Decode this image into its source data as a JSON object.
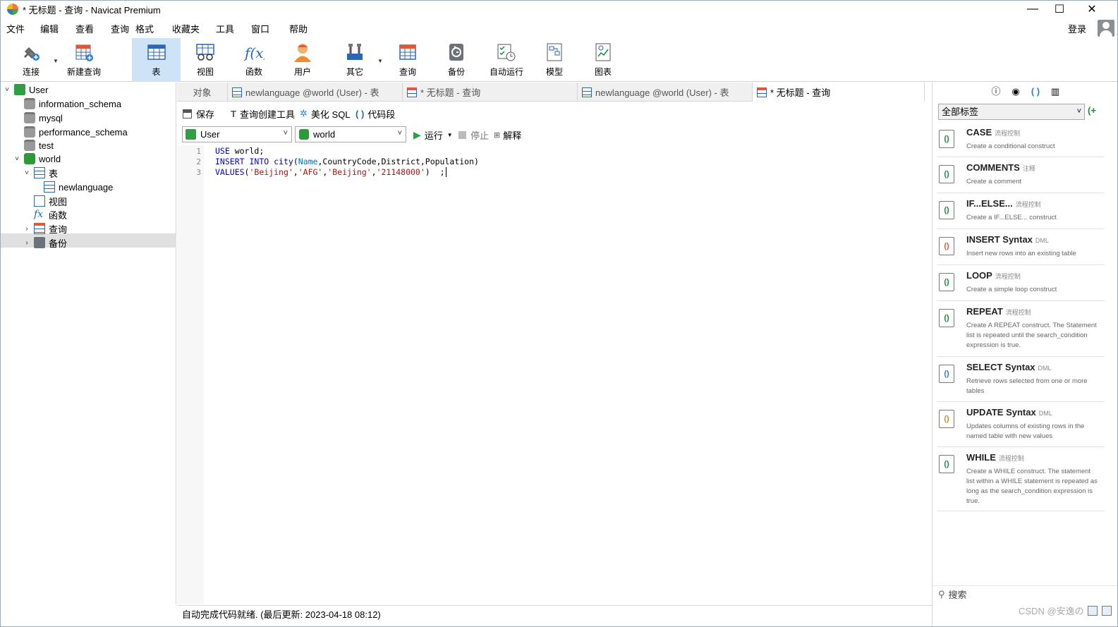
{
  "window": {
    "title": "* 无标题 - 查询 - Navicat Premium",
    "minimize": "—",
    "maximize": "☐",
    "close": "✕"
  },
  "menu": [
    "文件",
    "编辑",
    "查看",
    "查询",
    "格式",
    "收藏夹",
    "工具",
    "窗口",
    "帮助"
  ],
  "account": {
    "login": "登录"
  },
  "toolbar": [
    {
      "label": "连接",
      "icon": "connection-plug-icon"
    },
    {
      "label": "新建查询",
      "icon": "new-query-icon"
    },
    {
      "label": "表",
      "icon": "table-icon"
    },
    {
      "label": "视图",
      "icon": "view-icon"
    },
    {
      "label": "函数",
      "icon": "function-icon"
    },
    {
      "label": "用户",
      "icon": "user-icon"
    },
    {
      "label": "其它",
      "icon": "tools-icon"
    },
    {
      "label": "查询",
      "icon": "query-icon"
    },
    {
      "label": "备份",
      "icon": "backup-icon"
    },
    {
      "label": "自动运行",
      "icon": "automation-icon"
    },
    {
      "label": "模型",
      "icon": "model-icon"
    },
    {
      "label": "图表",
      "icon": "chart-icon"
    }
  ],
  "tree": {
    "connection": "User",
    "databases": [
      "information_schema",
      "mysql",
      "performance_schema",
      "test",
      "world"
    ],
    "world_children": {
      "tables": "表",
      "table_item": "newlanguage",
      "views": "视图",
      "functions": "函数",
      "queries": "查询",
      "backups": "备份"
    }
  },
  "tabs": [
    {
      "label": "对象"
    },
    {
      "label": "newlanguage @world (User) - 表"
    },
    {
      "label": "* 无标题 - 查询"
    },
    {
      "label": "newlanguage @world (User) - 表"
    },
    {
      "label": "* 无标题 - 查询"
    }
  ],
  "query_toolbar": {
    "save": "保存",
    "builder": "查询创建工具",
    "beautify": "美化 SQL",
    "snippet": "代码段"
  },
  "selectors": {
    "connection": "User",
    "database": "world",
    "run": "运行",
    "stop": "停止",
    "explain": "解释"
  },
  "editor": {
    "line_numbers": [
      "1",
      "2",
      "3"
    ],
    "line1": {
      "kw": "USE",
      "rest": " world;"
    },
    "line2": {
      "kw1": "INSERT",
      "kw2": "INTO",
      "fn": "city",
      "open": "(",
      "c1": "Name",
      "rest": ",CountryCode,District,Population)"
    },
    "line3": {
      "kw": "VALUES",
      "open": "(",
      "s1": "'Beijing'",
      "s2": "'AFG'",
      "s3": "'Beijing'",
      "s4": "'21148000'",
      "close": ")",
      "tail": "  ;"
    }
  },
  "status": {
    "text": "自动完成代码就绪. (最后更新: 2023-04-18 08:12)"
  },
  "right_panel": {
    "tag_filter": "全部标签",
    "snippets": [
      {
        "title": "CASE",
        "tag": "流程控制",
        "desc": "Create a conditional construct"
      },
      {
        "title": "COMMENTS",
        "tag": "注释",
        "desc": "Create a comment"
      },
      {
        "title": "IF...ELSE...",
        "tag": "流程控制",
        "desc": "Create a IF...ELSE... construct"
      },
      {
        "title": "INSERT Syntax",
        "tag": "DML",
        "desc": "Insert new rows into an existing table"
      },
      {
        "title": "LOOP",
        "tag": "流程控制",
        "desc": "Create a simple loop construct"
      },
      {
        "title": "REPEAT",
        "tag": "流程控制",
        "desc": "Create A REPEAT construct. The Statement list is repeated until the search_condition expression is true."
      },
      {
        "title": "SELECT Syntax",
        "tag": "DML",
        "desc": "Retrieve rows selected from one or more tables"
      },
      {
        "title": "UPDATE Syntax",
        "tag": "DML",
        "desc": "Updates columns of existing rows in the named table with new values"
      },
      {
        "title": "WHILE",
        "tag": "流程控制",
        "desc": "Create a WHILE construct. The statement list within a WHILE statement is repeated as long as the search_condition expression is true."
      }
    ],
    "search_placeholder": "搜索"
  },
  "watermark": "CSDN @安逸の"
}
